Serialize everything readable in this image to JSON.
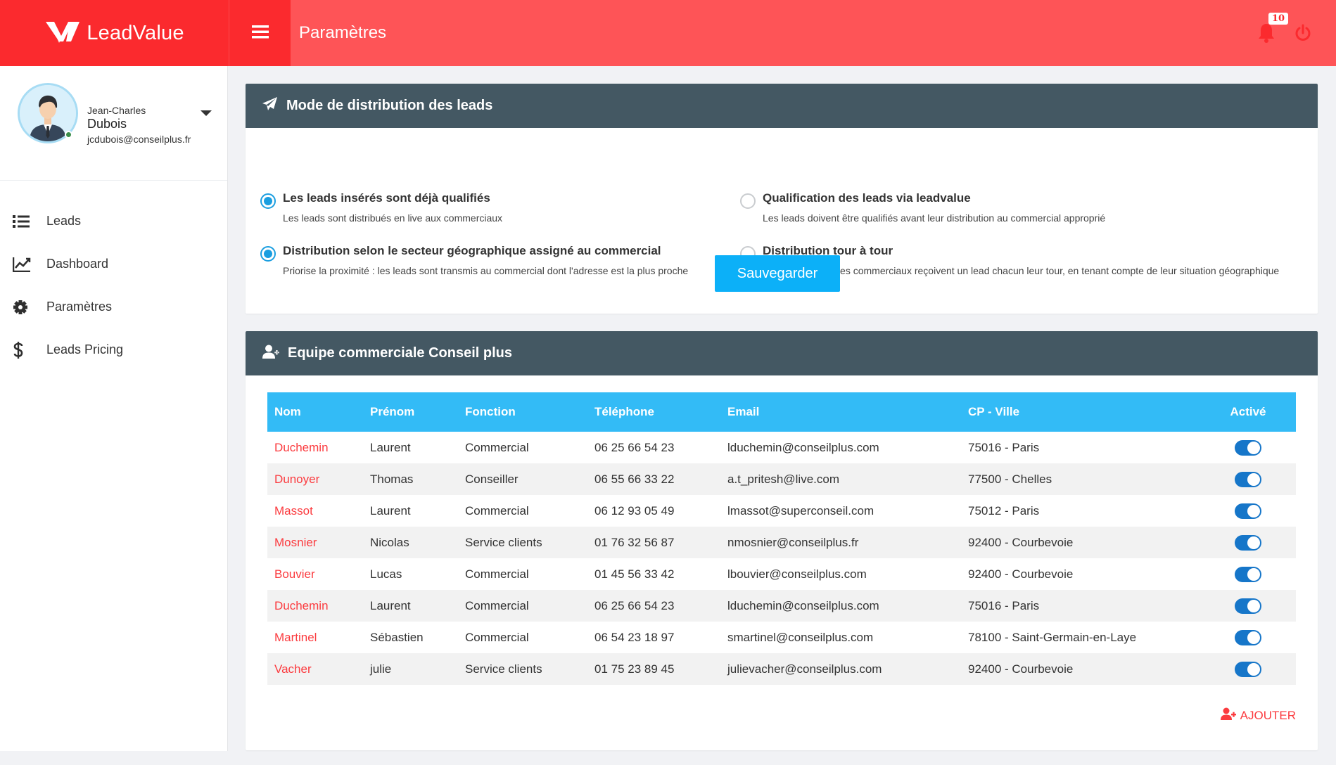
{
  "app": {
    "brand": "LeadValue",
    "page_title": "Paramètres",
    "notifications_count": "10",
    "colors": {
      "primary": "#fb2a2e",
      "header_bg": "#fe5457",
      "panel_head": "#445863",
      "accent": "#0cb0f8",
      "table_head": "#33bbf6",
      "toggle": "#1676c9"
    }
  },
  "user": {
    "first_name": "Jean-Charles",
    "last_name": "Dubois",
    "email": "jcdubois@conseilplus.fr"
  },
  "nav": [
    {
      "label": "Leads",
      "icon": "list-icon"
    },
    {
      "label": "Dashboard",
      "icon": "chart-line-icon"
    },
    {
      "label": "Paramètres",
      "icon": "gear-icon"
    },
    {
      "label": "Leads Pricing",
      "icon": "dollar-icon"
    }
  ],
  "distribution": {
    "title": "Mode de distribution des leads",
    "options": [
      {
        "title": "Les leads insérés sont déjà qualifiés",
        "desc": "Les leads sont distribués en live aux commerciaux",
        "checked": true
      },
      {
        "title": "Qualification des leads via leadvalue",
        "desc": "Les leads doivent être qualifiés avant leur distribution au commercial approprié",
        "checked": false
      },
      {
        "title": "Distribution selon le secteur géographique assigné au commercial",
        "desc": "Priorise la proximité : les leads sont transmis au commercial dont l'adresse est la plus proche",
        "checked": true
      },
      {
        "title": "Distribution tour à tour",
        "desc": "Priorise l'équité : les commerciaux reçoivent un lead chacun leur tour, en tenant compte de leur situation  géographique",
        "checked": false
      }
    ],
    "save_label": "Sauvegarder"
  },
  "team": {
    "title": "Equipe commerciale Conseil plus",
    "columns": [
      "Nom",
      "Prénom",
      "Fonction",
      "Téléphone",
      "Email",
      "CP - Ville",
      "Activé"
    ],
    "rows": [
      {
        "nom": "Duchemin",
        "prenom": "Laurent",
        "fonction": "Commercial",
        "tel": "06 25 66 54 23",
        "email": "lduchemin@conseilplus.com",
        "ville": "75016 - Paris",
        "active": true
      },
      {
        "nom": "Dunoyer",
        "prenom": "Thomas",
        "fonction": "Conseiller",
        "tel": "06 55 66 33 22",
        "email": "a.t_pritesh@live.com",
        "ville": "77500 - Chelles",
        "active": true
      },
      {
        "nom": "Massot",
        "prenom": "Laurent",
        "fonction": "Commercial",
        "tel": "06 12 93 05 49",
        "email": "lmassot@superconseil.com",
        "ville": "75012 - Paris",
        "active": true
      },
      {
        "nom": "Mosnier",
        "prenom": "Nicolas",
        "fonction": "Service clients",
        "tel": "01 76 32 56 87",
        "email": "nmosnier@conseilplus.fr",
        "ville": "92400 - Courbevoie",
        "active": true
      },
      {
        "nom": "Bouvier",
        "prenom": "Lucas",
        "fonction": "Commercial",
        "tel": "01 45 56 33 42",
        "email": "lbouvier@conseilplus.com",
        "ville": "92400 - Courbevoie",
        "active": true
      },
      {
        "nom": "Duchemin",
        "prenom": "Laurent",
        "fonction": "Commercial",
        "tel": "06 25 66 54 23",
        "email": "lduchemin@conseilplus.com",
        "ville": "75016 - Paris",
        "active": true
      },
      {
        "nom": "Martinel",
        "prenom": "Sébastien",
        "fonction": "Commercial",
        "tel": "06 54 23 18 97",
        "email": "smartinel@conseilplus.com",
        "ville": "78100 - Saint-Germain-en-Laye",
        "active": true
      },
      {
        "nom": "Vacher",
        "prenom": "julie",
        "fonction": "Service clients",
        "tel": "01 75 23 89 45",
        "email": "julievacher@conseilplus.com",
        "ville": "92400 - Courbevoie",
        "active": true
      }
    ],
    "add_label": "AJOUTER"
  }
}
